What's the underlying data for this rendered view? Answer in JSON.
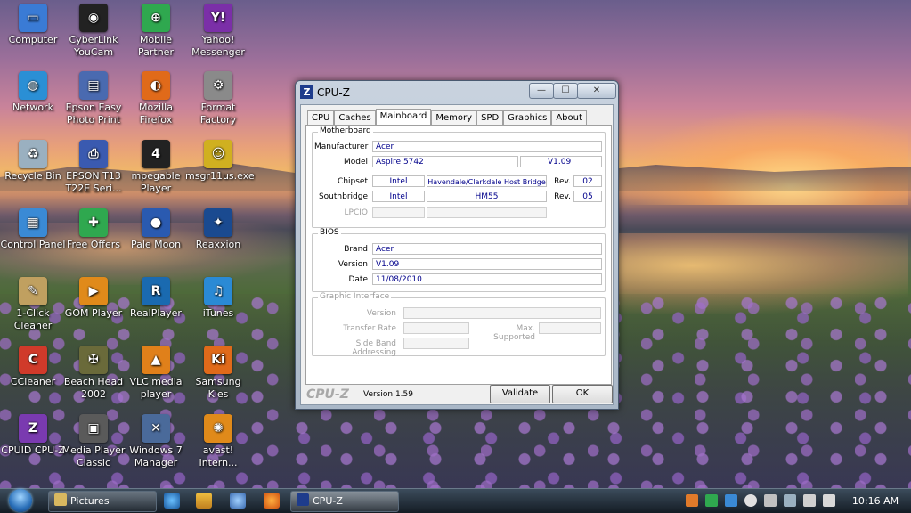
{
  "desktop": {
    "icons": [
      {
        "label": "Computer",
        "icon": "computer-icon",
        "color": "#3a7bd5",
        "glyph": "▭"
      },
      {
        "label": "CyberLink YouCam",
        "icon": "webcam-icon",
        "color": "#222222",
        "glyph": "◉"
      },
      {
        "label": "Mobile Partner",
        "icon": "mobile-partner-icon",
        "color": "#2fa84f",
        "glyph": "⊕"
      },
      {
        "label": "Yahoo! Messenger",
        "icon": "yahoo-messenger-icon",
        "color": "#7b2fa8",
        "glyph": "Y!"
      },
      {
        "label": "Network",
        "icon": "network-icon",
        "color": "#2a8fd5",
        "glyph": "◍"
      },
      {
        "label": "Epson Easy Photo Print",
        "icon": "epson-photo-icon",
        "color": "#4a6ab0",
        "glyph": "▤"
      },
      {
        "label": "Mozilla Firefox",
        "icon": "firefox-icon",
        "color": "#e06a1a",
        "glyph": "◐"
      },
      {
        "label": "Format Factory",
        "icon": "format-factory-icon",
        "color": "#8a8a8a",
        "glyph": "⚙"
      },
      {
        "label": "Recycle Bin",
        "icon": "recycle-bin-icon",
        "color": "#9ab0c0",
        "glyph": "♻"
      },
      {
        "label": "EPSON T13 T22E Seri...",
        "icon": "printer-icon",
        "color": "#3a5ab0",
        "glyph": "⎙"
      },
      {
        "label": "mpegable Player",
        "icon": "mpegable-icon",
        "color": "#222222",
        "glyph": "4"
      },
      {
        "label": "msgr11us.exe",
        "icon": "msgr-installer-icon",
        "color": "#d0b020",
        "glyph": "☺"
      },
      {
        "label": "Control Panel",
        "icon": "control-panel-icon",
        "color": "#3a8ad5",
        "glyph": "▦"
      },
      {
        "label": "Free Offers",
        "icon": "gift-icon",
        "color": "#2fa84f",
        "glyph": "✚"
      },
      {
        "label": "Pale Moon",
        "icon": "pale-moon-icon",
        "color": "#2a5ab0",
        "glyph": "●"
      },
      {
        "label": "Reaxxion",
        "icon": "reaxxion-icon",
        "color": "#1a4a90",
        "glyph": "✦"
      },
      {
        "label": "1-Click Cleaner",
        "icon": "cleaner-icon",
        "color": "#c0a060",
        "glyph": "✎"
      },
      {
        "label": "GOM Player",
        "icon": "gom-player-icon",
        "color": "#e08a1a",
        "glyph": "▶"
      },
      {
        "label": "RealPlayer",
        "icon": "realplayer-icon",
        "color": "#1a6ab0",
        "glyph": "R"
      },
      {
        "label": "iTunes",
        "icon": "itunes-icon",
        "color": "#2a8ad5",
        "glyph": "♫"
      },
      {
        "label": "CCleaner",
        "icon": "ccleaner-icon",
        "color": "#d03a2a",
        "glyph": "C"
      },
      {
        "label": "Beach Head 2002",
        "icon": "beach-head-icon",
        "color": "#6a6a3a",
        "glyph": "✠"
      },
      {
        "label": "VLC media player",
        "icon": "vlc-icon",
        "color": "#e0801a",
        "glyph": "▲"
      },
      {
        "label": "Samsung Kies",
        "icon": "samsung-kies-icon",
        "color": "#e06a1a",
        "glyph": "Ki"
      },
      {
        "label": "CPUID CPU-Z",
        "icon": "cpuz-desktop-icon",
        "color": "#7a3ab0",
        "glyph": "Z"
      },
      {
        "label": "Media Player Classic",
        "icon": "media-player-classic-icon",
        "color": "#5a5a5a",
        "glyph": "▣"
      },
      {
        "label": "Windows 7 Manager",
        "icon": "windows7-manager-icon",
        "color": "#4a6a9a",
        "glyph": "✕"
      },
      {
        "label": "avast! Intern...",
        "icon": "avast-icon",
        "color": "#e08a1a",
        "glyph": "✺"
      }
    ]
  },
  "window": {
    "title": "CPU-Z",
    "logo": "Z",
    "minimize_glyph": "—",
    "maximize_glyph": "☐",
    "close_glyph": "✕",
    "tabs": [
      "CPU",
      "Caches",
      "Mainboard",
      "Memory",
      "SPD",
      "Graphics",
      "About"
    ],
    "active_tab": "Mainboard",
    "motherboard": {
      "title": "Motherboard",
      "manufacturer_label": "Manufacturer",
      "manufacturer": "Acer",
      "model_label": "Model",
      "model": "Aspire 5742",
      "model_version": "V1.09",
      "chipset_label": "Chipset",
      "chipset_vendor": "Intel",
      "chipset_name": "Havendale/Clarkdale Host Bridge",
      "chipset_rev_label": "Rev.",
      "chipset_rev": "02",
      "southbridge_label": "Southbridge",
      "southbridge_vendor": "Intel",
      "southbridge_name": "HM55",
      "southbridge_rev_label": "Rev.",
      "southbridge_rev": "05",
      "lpcio_label": "LPCIO"
    },
    "bios": {
      "title": "BIOS",
      "brand_label": "Brand",
      "brand": "Acer",
      "version_label": "Version",
      "version": "V1.09",
      "date_label": "Date",
      "date": "11/08/2010"
    },
    "graphic_interface": {
      "title": "Graphic Interface",
      "version_label": "Version",
      "transfer_rate_label": "Transfer Rate",
      "max_supported_label": "Max. Supported",
      "side_band_label": "Side Band Addressing"
    },
    "footer": {
      "logo": "CPU-Z",
      "version": "Version 1.59",
      "validate_label": "Validate",
      "ok_label": "OK"
    }
  },
  "taskbar": {
    "buttons": [
      {
        "label": "Pictures",
        "icon": "folder-icon"
      },
      {
        "label": "CPU-Z",
        "icon": "cpuz-taskbar-icon"
      }
    ],
    "clock": "10:16 AM"
  }
}
